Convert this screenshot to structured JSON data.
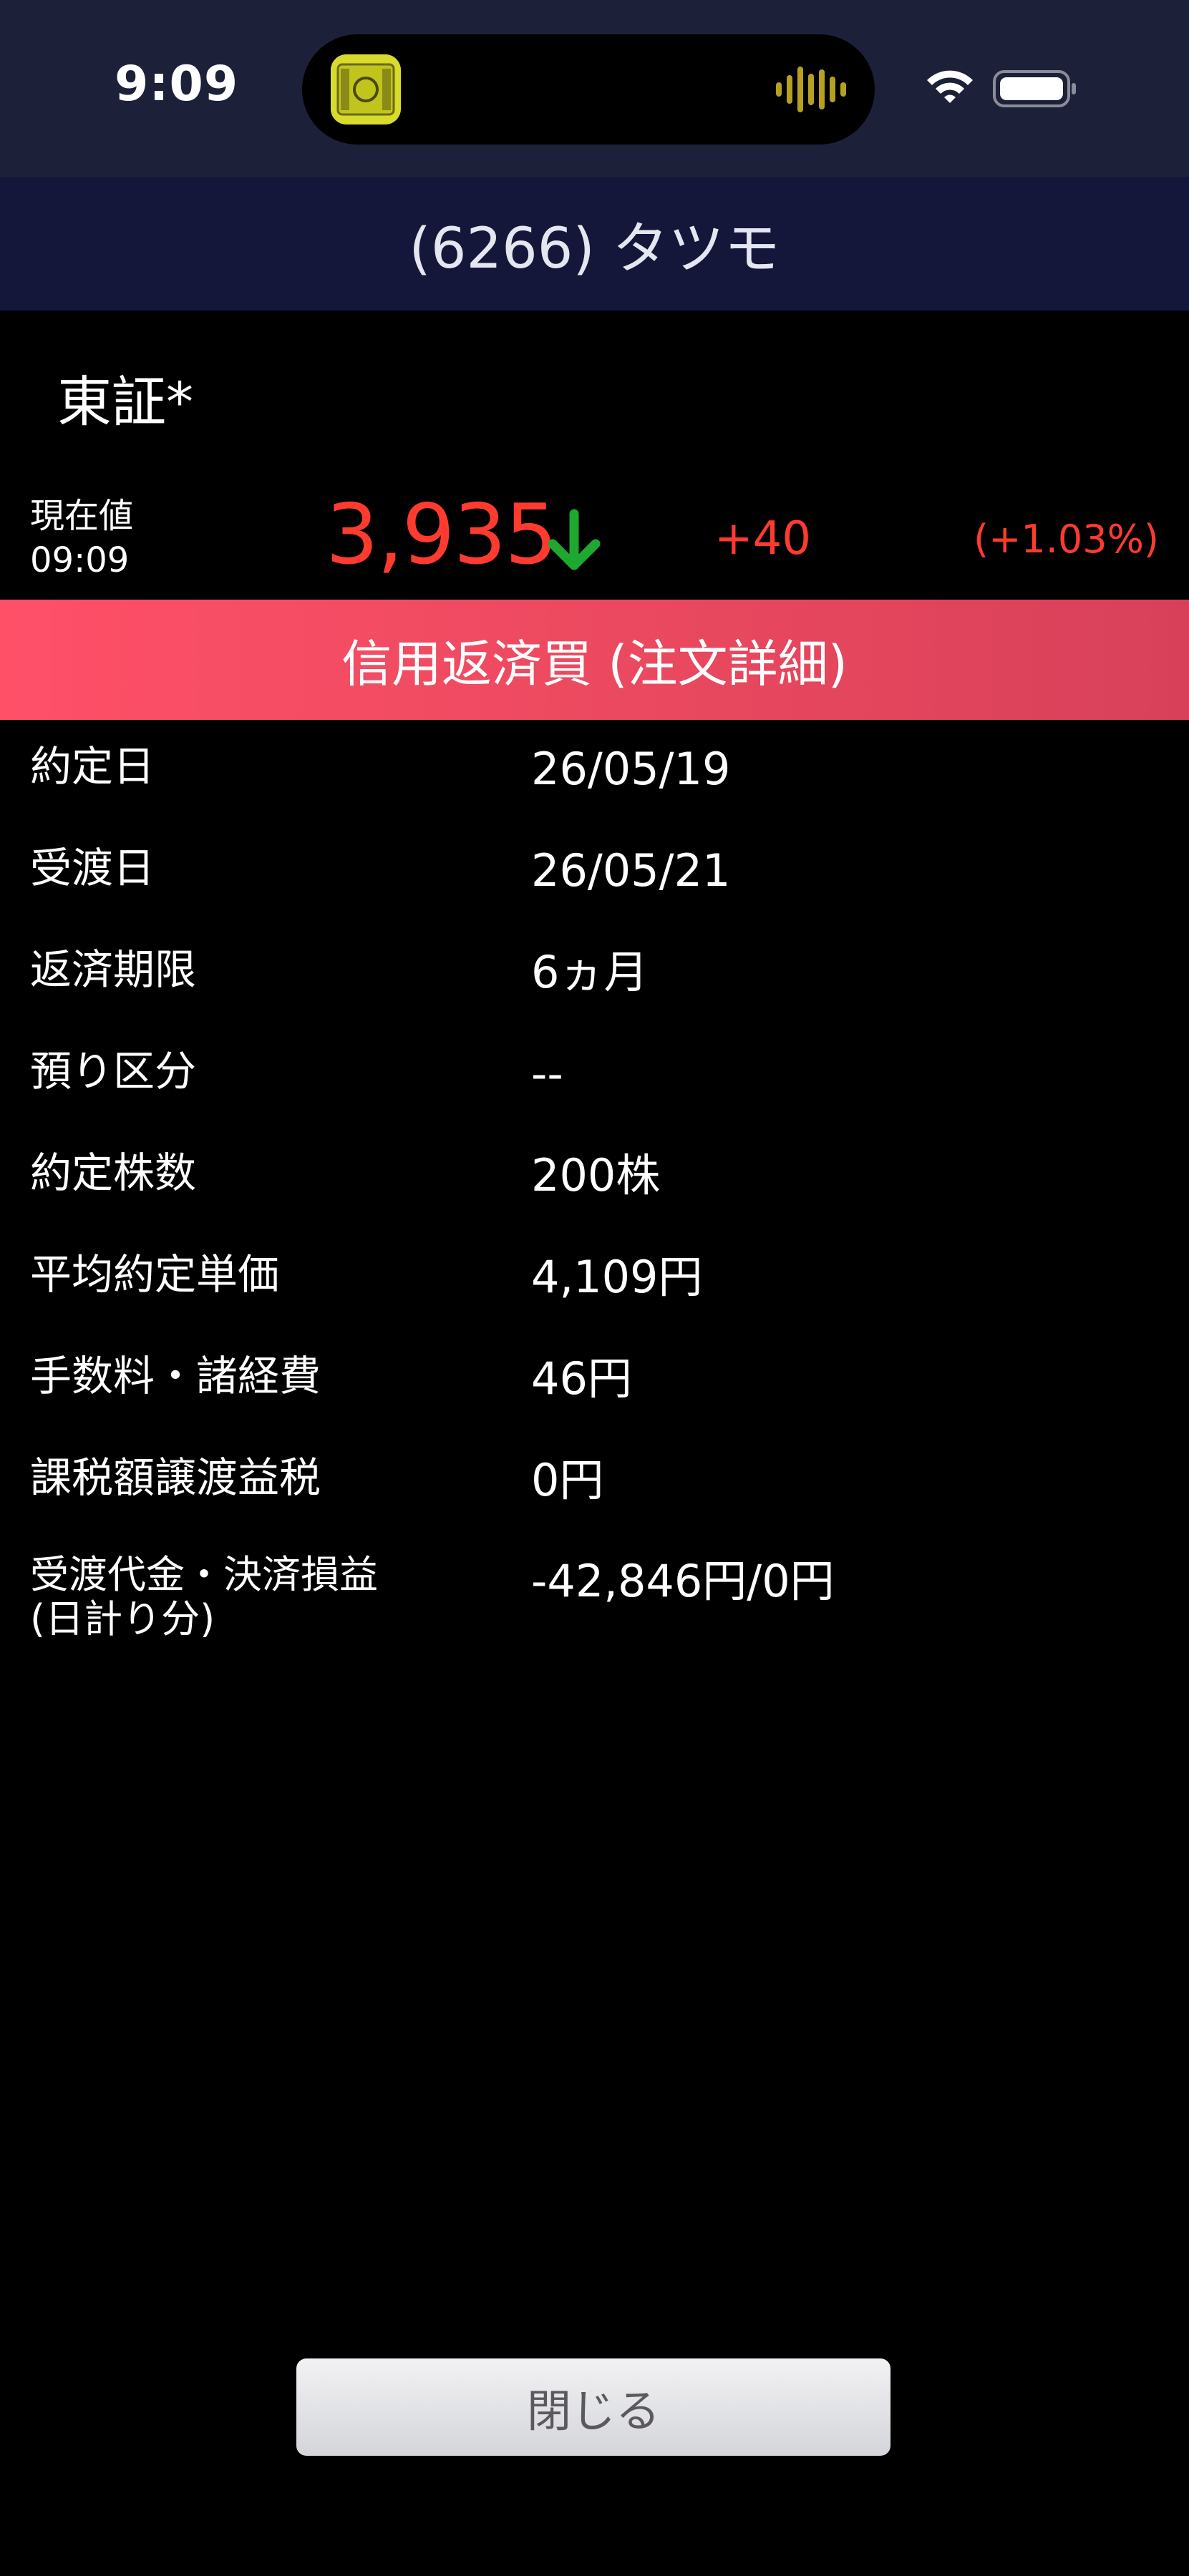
{
  "status_bar": {
    "time": "9:09",
    "battery_level": 1.0
  },
  "header": {
    "title": "(6266) タツモ"
  },
  "quote": {
    "market": "東証*",
    "label": "現在値",
    "time": "09:09",
    "price": "3,935",
    "trend": "down",
    "change": "+40",
    "change_pct": "(+1.03%)",
    "colors": {
      "price": "#ff3b30",
      "arrow": "#1fa82f"
    }
  },
  "order": {
    "header_label": "信用返済買 (注文詳細)",
    "header_color": "#ff5068",
    "details": [
      {
        "label": "約定日",
        "value": "26/05/19"
      },
      {
        "label": "受渡日",
        "value": "26/05/21"
      },
      {
        "label": "返済期限",
        "value": "6ヵ月"
      },
      {
        "label": "預り区分",
        "value": "--"
      },
      {
        "label": "約定株数",
        "value": "200株"
      },
      {
        "label": "平均約定単価",
        "value": "4,109円"
      },
      {
        "label": "手数料・諸経費",
        "value": "46円"
      },
      {
        "label": "課税額譲渡益税",
        "value": "0円"
      }
    ],
    "settlement": {
      "label_line1": "受渡代金・決済損益",
      "label_line2": "(日計り分)",
      "value": "-42,846円/0円"
    }
  },
  "footer": {
    "close_label": "閉じる"
  },
  "icons": {
    "island_app": "app-icon",
    "island_audio": "audio-wave-icon",
    "wifi": "wifi-icon",
    "battery": "battery-icon",
    "trend": "arrow-down-icon"
  }
}
